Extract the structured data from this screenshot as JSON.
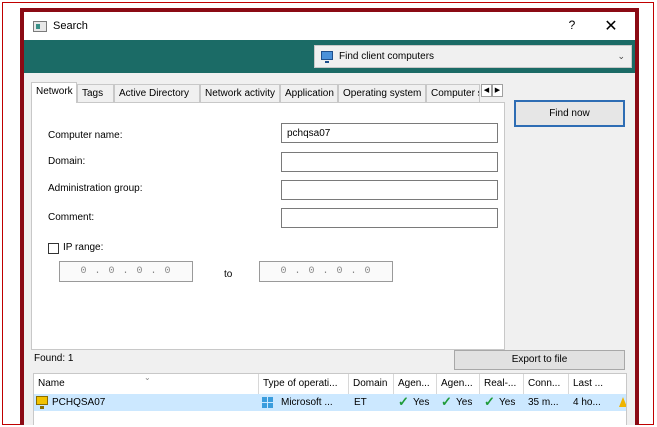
{
  "window": {
    "title": "Search",
    "help_label": "?",
    "close_label": "✕"
  },
  "target": {
    "selected": "Find client computers",
    "icon": "computer-monitor-icon"
  },
  "tabs": [
    {
      "label": "Network",
      "active": true
    },
    {
      "label": "Tags"
    },
    {
      "label": "Active Directory"
    },
    {
      "label": "Network activity"
    },
    {
      "label": "Application"
    },
    {
      "label": "Operating system"
    },
    {
      "label": "Computer s"
    }
  ],
  "tab_scroll": {
    "left": "◀",
    "right": "▶"
  },
  "form": {
    "computer_name_label": "Computer name:",
    "computer_name_value": "pchqsa07",
    "domain_label": "Domain:",
    "domain_value": "",
    "admin_group_label": "Administration group:",
    "admin_group_value": "",
    "comment_label": "Comment:",
    "comment_value": "",
    "ip_range_label": "IP range:",
    "ip_range_checked": false,
    "ip_from": "0 . 0 . 0 . 0",
    "ip_to": "0 . 0 . 0 . 0",
    "to_label": "to"
  },
  "buttons": {
    "find_now": "Find now",
    "export": "Export to file"
  },
  "results": {
    "found_label": "Found: 1",
    "columns": [
      "Name",
      "Type of operati...",
      "Domain",
      "Agen...",
      "Agen...",
      "Real-...",
      "Conn...",
      "Last ..."
    ],
    "rows": [
      {
        "name": "PCHQSA07",
        "os_type": "Microsoft ...",
        "domain": "ET",
        "agent1": "Yes",
        "agent2": "Yes",
        "realtime": "Yes",
        "connected": "35 m...",
        "last": "4 ho..."
      }
    ]
  },
  "colors": {
    "teal_bar": "#1b6b66",
    "frame": "#8b0a14",
    "selected_row": "#cce8ff",
    "accent_button": "#2e6db4"
  }
}
